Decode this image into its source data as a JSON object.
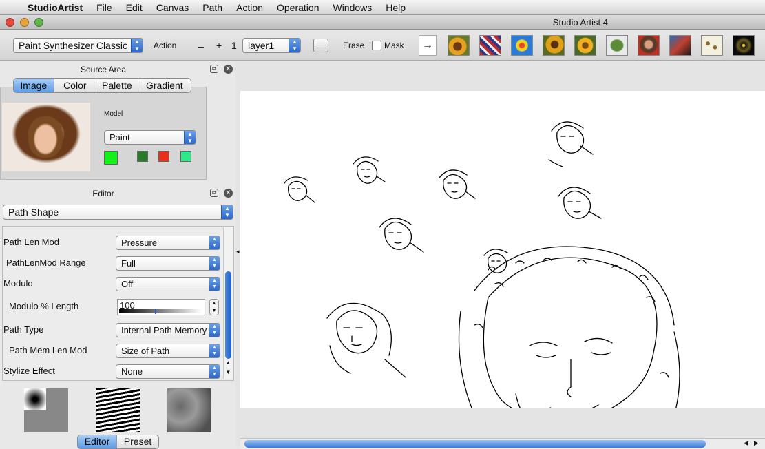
{
  "menubar": {
    "app": "StudioArtist",
    "items": [
      "File",
      "Edit",
      "Canvas",
      "Path",
      "Action",
      "Operation",
      "Windows",
      "Help"
    ]
  },
  "window": {
    "title": "Studio Artist 4"
  },
  "toolbar": {
    "synth_select": "Paint Synthesizer Classic",
    "action_label": "Action",
    "minus": "–",
    "plus": "+",
    "layer_num": "1",
    "layer_select": "layer1",
    "erase_label": "Erase",
    "mask_label": "Mask",
    "arrow_icon": "→",
    "thumbnails": [
      "sunflower-preset-icon",
      "fabric-preset-icon",
      "kaleido-preset-icon",
      "sunflower-2-preset-icon",
      "sunflower-3-preset-icon",
      "leaf-preset-icon",
      "portrait-preset-icon",
      "abstract-preset-icon",
      "dots-preset-icon",
      "fireworks-preset-icon"
    ]
  },
  "source": {
    "title": "Source Area",
    "tabs": [
      "Image",
      "Color",
      "Palette",
      "Gradient"
    ],
    "selected_tab": "Image",
    "model_label": "Model",
    "model_select": "Paint",
    "swatches": [
      "#13f01a",
      "#2b7a2b",
      "#e8301a",
      "#2aea8a"
    ]
  },
  "editor": {
    "title": "Editor",
    "section_select": "Path Shape",
    "rows": [
      {
        "label": "Path Len Mod",
        "value": "Pressure"
      },
      {
        "label": "PathLenMod Range",
        "value": "Full"
      },
      {
        "label": "Modulo",
        "value": "Off"
      },
      {
        "label": "Modulo % Length",
        "value": "100"
      },
      {
        "label": "Path Type",
        "value": "Internal Path Memory"
      },
      {
        "label": "Path Mem Len Mod",
        "value": "Size of Path"
      },
      {
        "label": "Stylize Effect",
        "value": "None"
      }
    ],
    "bottom_tabs": [
      "Editor",
      "Preset"
    ]
  },
  "colors": {
    "accent": "#5c9be6",
    "canvas": "#ffffff"
  }
}
